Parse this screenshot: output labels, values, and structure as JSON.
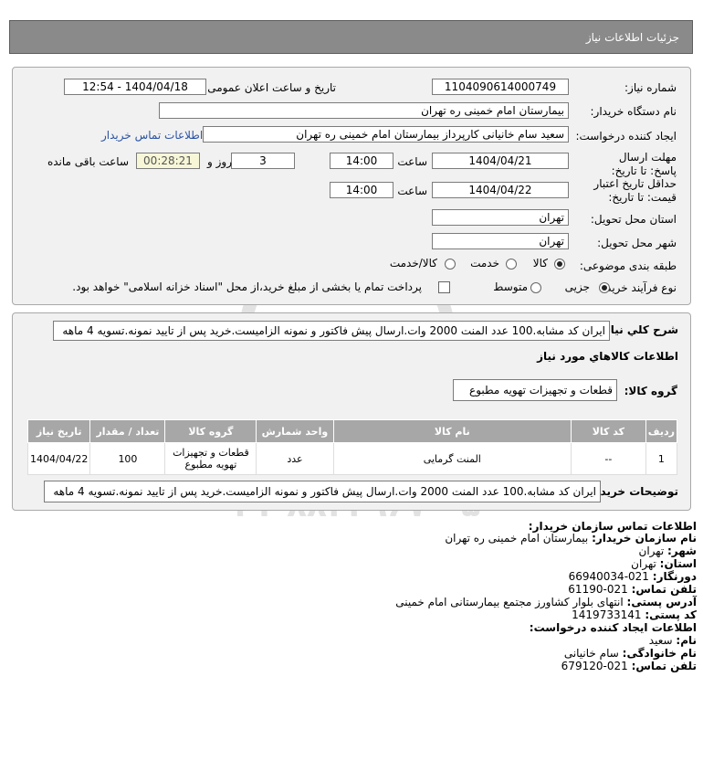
{
  "header": {
    "title": "جزئیات اطلاعات نیاز"
  },
  "form": {
    "need_number_label": "شماره نیاز:",
    "need_number": "1104090614000749",
    "announce_label": "تاریخ و ساعت اعلان عمومی:",
    "announce_value": "1404/04/18 - 12:54",
    "buyer_org_label": "نام دستگاه خریدار:",
    "buyer_org": "بیمارستان امام خمینی ره  تهران",
    "creator_label": "ایجاد کننده درخواست:",
    "creator": "سعید سام خانیانی کارپرداز بیمارستان امام خمینی ره  تهران",
    "contact_link": "اطلاعات تماس خریدار",
    "deadline_label": "مهلت ارسال پاسخ: تا تاریخ:",
    "deadline_date": "1404/04/21",
    "time_label": "ساعت",
    "deadline_time": "14:00",
    "days": "3",
    "days_label": "روز و",
    "remaining": "00:28:21",
    "remaining_label": "ساعت باقی مانده",
    "validity_label": "حداقل تاریخ اعتبار قیمت: تا تاریخ:",
    "validity_date": "1404/04/22",
    "validity_time": "14:00",
    "province_label": "استان محل تحویل:",
    "province": "تهران",
    "city_label": "شهر محل تحویل:",
    "city": "تهران",
    "category_label": "طبقه بندی موضوعی:",
    "category_options": [
      "کالا",
      "خدمت",
      "کالا/خدمت"
    ],
    "process_label": "نوع فرآیند خرید :",
    "process_options": [
      "جزیی",
      "متوسط"
    ],
    "payment_note": "پرداخت تمام یا بخشی از مبلغ خرید،از محل \"اسناد خزانه اسلامی\" خواهد بود."
  },
  "details": {
    "summary_label": "شرح کلي نياز:",
    "summary": "ایران کد مشابه.100 عدد المنت 2000 وات.ارسال پیش فاکتور و نمونه الزامیست.خرید پس از تایید نمونه.تسویه 4 ماهه",
    "goods_info_title": "اطلاعات کالاهاي مورد نياز",
    "goods_group_label": "گروه کالا:",
    "goods_group": "قطعات و تجهیزات تهویه مطبوع",
    "columns": [
      "ردیف",
      "کد کالا",
      "نام کالا",
      "واحد شمارش",
      "گروه کالا",
      "تعداد / مقدار",
      "تاریخ نیاز"
    ],
    "rows": [
      [
        "1",
        "--",
        "المنت گرمایی",
        "عدد",
        "قطعات و تجهیزات تهویه مطبوع",
        "100",
        "1404/04/22"
      ]
    ],
    "buyer_notes_label": "توضیحات خریدار:",
    "buyer_notes": "ایران کد مشابه.100 عدد المنت 2000 وات.ارسال پیش فاکتور و نمونه الزامیست.خرید پس از تایید نمونه.تسویه 4 ماهه"
  },
  "contact": {
    "title": "اطلاعات تماس سازمان خریدار:",
    "lines": [
      {
        "label": "نام سازمان خریدار:",
        "value": "بیمارستان امام خمینی ره تهران"
      },
      {
        "label": "شهر:",
        "value": "تهران"
      },
      {
        "label": "استان:",
        "value": "تهران"
      },
      {
        "label": "دورنگار:",
        "value": "021-66940034"
      },
      {
        "label": "تلفن تماس:",
        "value": "021-61190"
      },
      {
        "label": "آدرس پستی:",
        "value": "انتهای بلوار کشاورز مجتمع بیمارستانی امام خمینی"
      },
      {
        "label": "کد پستی:",
        "value": "1419733141"
      }
    ],
    "creator_title": "اطلاعات ایجاد کننده درخواست:",
    "creator_lines": [
      {
        "label": "نام:",
        "value": "سعید"
      },
      {
        "label": "نام خانوادگی:",
        "value": "سام خانیانی"
      },
      {
        "label": "تلفن تماس:",
        "value": "021-679120"
      }
    ]
  },
  "watermark": {
    "brand": "ParsNamadData",
    "line1": "مرکز فراوری اطلاعات پارس نماد داده",
    "line2": "۰۲۱-۸۸۳۴۹۶۷۰-۵",
    "digits": "010101"
  }
}
